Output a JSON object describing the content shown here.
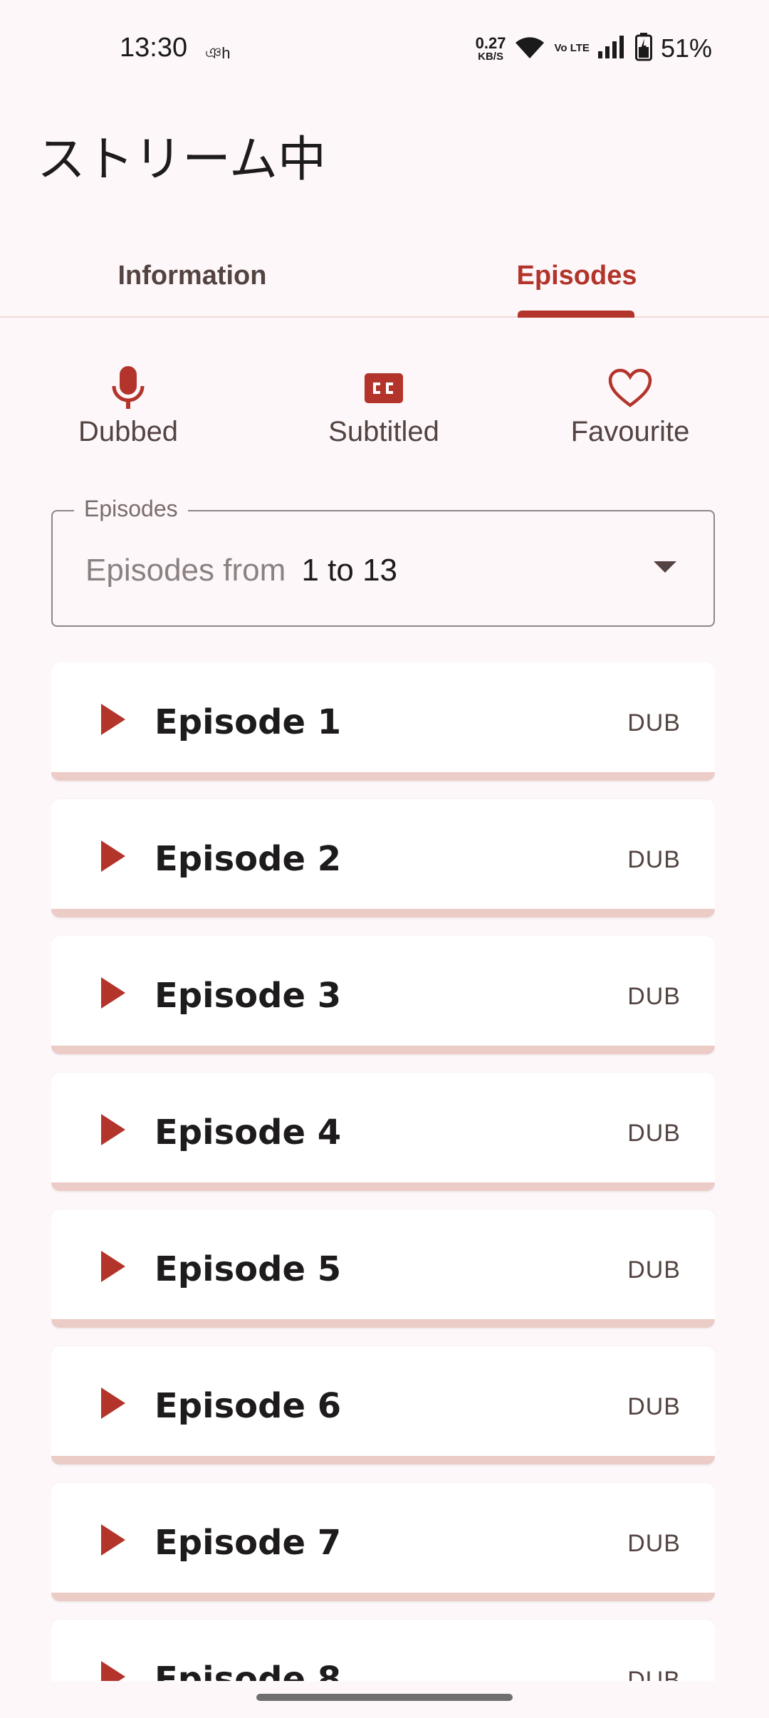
{
  "status_bar": {
    "time": "13:30",
    "extra": "ঞh",
    "net_speed": "0.27",
    "net_unit": "KB/S",
    "volte": "Vo LTE",
    "battery": "51%"
  },
  "app": {
    "title": "ストリーム中"
  },
  "tabs": [
    {
      "label": "Information",
      "selected": false
    },
    {
      "label": "Episodes",
      "selected": true
    }
  ],
  "actions": [
    {
      "label": "Dubbed",
      "icon": "microphone-icon"
    },
    {
      "label": "Subtitled",
      "icon": "closed-captions-icon"
    },
    {
      "label": "Favourite",
      "icon": "heart-outline-icon"
    }
  ],
  "episode_select": {
    "legend": "Episodes",
    "prefix": "Episodes from",
    "range": "1 to 13"
  },
  "episodes": [
    {
      "title": "Episode 1",
      "badge": "DUB"
    },
    {
      "title": "Episode 2",
      "badge": "DUB"
    },
    {
      "title": "Episode 3",
      "badge": "DUB"
    },
    {
      "title": "Episode 4",
      "badge": "DUB"
    },
    {
      "title": "Episode 5",
      "badge": "DUB"
    },
    {
      "title": "Episode 6",
      "badge": "DUB"
    },
    {
      "title": "Episode 7",
      "badge": "DUB"
    },
    {
      "title": "Episode 8",
      "badge": "DUB"
    }
  ],
  "colors": {
    "accent": "#b3342a",
    "background": "#fdf7fa",
    "card_underline": "#ecccc6"
  }
}
